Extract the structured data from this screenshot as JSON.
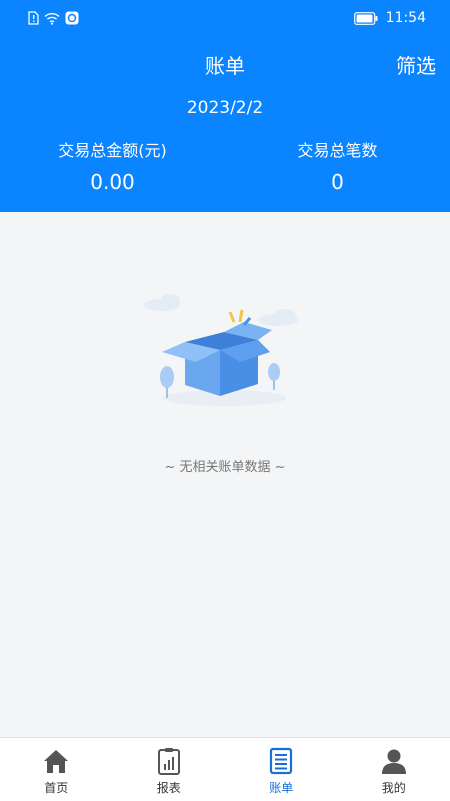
{
  "status_bar": {
    "time": "11:54"
  },
  "header": {
    "title": "账单",
    "filter_label": "筛选",
    "date": "2023/2/2",
    "total_amount_label": "交易总金额(元)",
    "total_amount_value": "0.00",
    "total_count_label": "交易总笔数",
    "total_count_value": "0"
  },
  "empty_state": {
    "message": "~ 无相关账单数据 ~"
  },
  "tabbar": {
    "items": [
      {
        "label": "首页",
        "icon": "home-icon",
        "active": false
      },
      {
        "label": "报表",
        "icon": "report-icon",
        "active": false
      },
      {
        "label": "账单",
        "icon": "bill-icon",
        "active": true
      },
      {
        "label": "我的",
        "icon": "profile-icon",
        "active": false
      }
    ]
  },
  "colors": {
    "accent": "#0a84ff",
    "active_tab": "#1a6ed8",
    "background": "#f4f5f7"
  }
}
